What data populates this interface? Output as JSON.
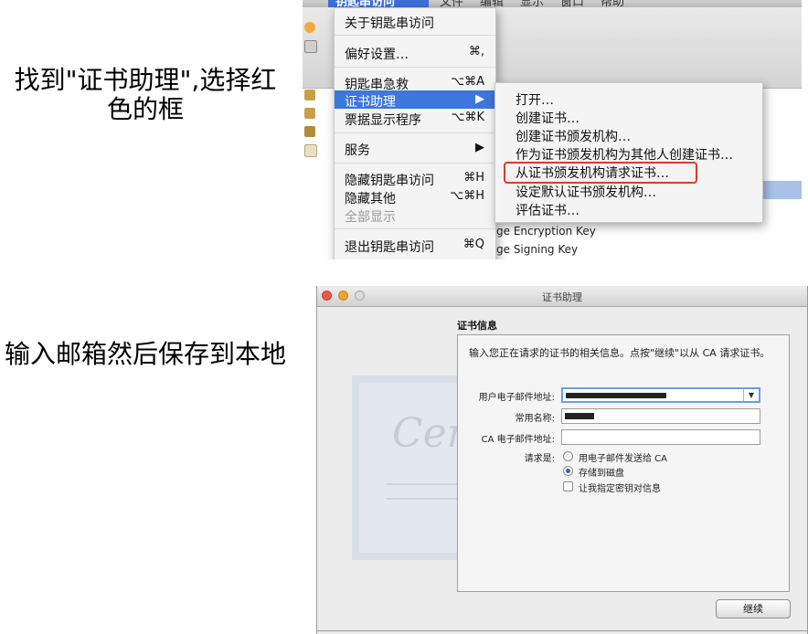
{
  "captions": {
    "step1": "找到\"证书助理\",选择红色的框",
    "step2": "输入邮箱然后保存到本地"
  },
  "menu_screenshot": {
    "menubar": {
      "active": "钥匙串访问",
      "items": [
        "文件",
        "编辑",
        "显示",
        "窗口",
        "帮助"
      ]
    },
    "main_menu": [
      {
        "label": "关于钥匙串访问",
        "shortcut": ""
      },
      {
        "label": "偏好设置…",
        "shortcut": "⌘,"
      },
      {
        "label": "钥匙串急救",
        "shortcut": "⌥⌘A"
      },
      {
        "label": "证书助理",
        "shortcut": "▶"
      },
      {
        "label": "票据显示程序",
        "shortcut": "⌥⌘K"
      },
      {
        "label": "服务",
        "shortcut": "▶"
      },
      {
        "label": "隐藏钥匙串访问",
        "shortcut": "⌘H"
      },
      {
        "label": "隐藏其他",
        "shortcut": "⌥⌘H"
      },
      {
        "label": "全部显示",
        "shortcut": ""
      },
      {
        "label": "退出钥匙串访问",
        "shortcut": "⌘Q"
      }
    ],
    "submenu": [
      "打开…",
      "创建证书…",
      "创建证书颁发机构…",
      "作为证书颁发机构为其他人创建证书…",
      "从证书颁发机构请求证书…",
      "设定默认证书颁发机构…",
      "评估证书…"
    ],
    "background_rows": [
      "ge Encryption Key",
      "ge Signing Key"
    ]
  },
  "assistant_screenshot": {
    "window_title": "证书助理",
    "section_title": "证书信息",
    "intro": "输入您正在请求的证书的相关信息。点按\"继续\"以从 CA 请求证书。",
    "fields": {
      "email_label": "用户电子邮件地址:",
      "name_label": "常用名称:",
      "ca_label": "CA 电子邮件地址:",
      "request_label": "请求是:"
    },
    "options": {
      "email_ca": "用电子邮件发送给 CA",
      "save_disk": "存储到磁盘",
      "specify_key": "让我指定密钥对信息"
    },
    "selected_option": "存储到磁盘",
    "background_art_text": "Certif",
    "continue_label": "继续"
  }
}
